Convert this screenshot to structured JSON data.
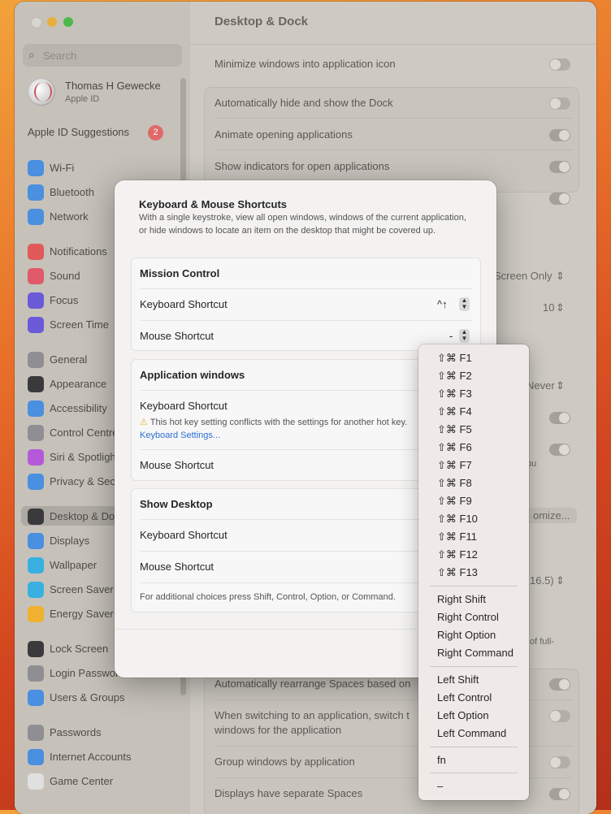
{
  "window": {
    "title": "Desktop & Dock"
  },
  "sidebar": {
    "search_placeholder": "Search",
    "user_name": "Thomas H Gewecke",
    "user_sub": "Apple ID",
    "suggestions": "Apple ID Suggestions",
    "suggestions_count": "2",
    "items": [
      {
        "label": "Wi-Fi",
        "color": "#4a8fe0",
        "icon": "wifi-icon"
      },
      {
        "label": "Bluetooth",
        "color": "#4a8fe0",
        "icon": "bluetooth-icon"
      },
      {
        "label": "Network",
        "color": "#4a8fe0",
        "icon": "globe-icon"
      },
      {
        "label": "Notifications",
        "color": "#e05a5a",
        "icon": "bell-icon"
      },
      {
        "label": "Sound",
        "color": "#e05a6a",
        "icon": "speaker-icon"
      },
      {
        "label": "Focus",
        "color": "#6a5ad8",
        "icon": "moon-icon"
      },
      {
        "label": "Screen Time",
        "color": "#6a5ad8",
        "icon": "hourglass-icon"
      },
      {
        "label": "General",
        "color": "#8e8e93",
        "icon": "gear-icon"
      },
      {
        "label": "Appearance",
        "color": "#3a3a3c",
        "icon": "appearance-icon"
      },
      {
        "label": "Accessibility",
        "color": "#4a8fe0",
        "icon": "accessibility-icon"
      },
      {
        "label": "Control Centre",
        "color": "#8e8e93",
        "icon": "control-centre-icon"
      },
      {
        "label": "Siri & Spotlight",
        "color": "#b45ad8",
        "icon": "siri-icon"
      },
      {
        "label": "Privacy & Security",
        "color": "#4a8fe0",
        "icon": "hand-icon"
      },
      {
        "label": "Desktop & Dock",
        "color": "#3a3a3c",
        "icon": "dock-icon"
      },
      {
        "label": "Displays",
        "color": "#4a8fe0",
        "icon": "sun-icon"
      },
      {
        "label": "Wallpaper",
        "color": "#3ab0e0",
        "icon": "wallpaper-icon"
      },
      {
        "label": "Screen Saver",
        "color": "#3ab0e0",
        "icon": "screensaver-icon"
      },
      {
        "label": "Energy Saver",
        "color": "#f0b030",
        "icon": "bulb-icon"
      },
      {
        "label": "Lock Screen",
        "color": "#3a3a3c",
        "icon": "lock-icon"
      },
      {
        "label": "Login Password",
        "color": "#8e8e93",
        "icon": "lock-icon"
      },
      {
        "label": "Users & Groups",
        "color": "#4a8fe0",
        "icon": "users-icon"
      },
      {
        "label": "Passwords",
        "color": "#8e8e93",
        "icon": "key-icon"
      },
      {
        "label": "Internet Accounts",
        "color": "#4a8fe0",
        "icon": "at-icon"
      },
      {
        "label": "Game Center",
        "color": "#e0e0e0",
        "icon": "gamecenter-icon"
      }
    ]
  },
  "main": {
    "rows": {
      "minimize": "Minimize windows into application icon",
      "autohide": "Automatically hide and show the Dock",
      "animate": "Animate opening applications",
      "indicators": "Show indicators for open applications",
      "screen_only": "Screen Only",
      "ten": "10",
      "never": "Never",
      "ou": "ou",
      "customize": "omize...",
      "version": "16.5)",
      "of_full": "of full-",
      "rearrange": "Automatically rearrange Spaces based on",
      "switching": "When switching to an application, switch t",
      "switching2": "windows for the application",
      "group": "Group windows by application",
      "separate": "Displays have separate Spaces"
    }
  },
  "dialog": {
    "title": "Keyboard & Mouse Shortcuts",
    "description": "With a single keystroke, view all open windows, windows of the current application, or hide windows to locate an item on the desktop that might be covered up.",
    "mission": {
      "title": "Mission Control",
      "kb_label": "Keyboard Shortcut",
      "kb_value": "^↑",
      "mouse_label": "Mouse Shortcut",
      "mouse_value": "-"
    },
    "appwin": {
      "title": "Application windows",
      "kb_label": "Keyboard Shortcut",
      "warning": "This hot key setting conflicts with the settings for another hot key.",
      "warning_link": "Keyboard Settings...",
      "mouse_label": "Mouse Shortcut"
    },
    "desktop": {
      "title": "Show Desktop",
      "kb_label": "Keyboard Shortcut",
      "mouse_label": "Mouse Shortcut",
      "footer": "For additional choices press Shift, Control, Option, or Command."
    }
  },
  "menu": {
    "fkeys": [
      "⇧⌘ F1",
      "⇧⌘ F2",
      "⇧⌘ F3",
      "⇧⌘ F4",
      "⇧⌘ F5",
      "⇧⌘ F6",
      "⇧⌘ F7",
      "⇧⌘ F8",
      "⇧⌘ F9",
      "⇧⌘ F10",
      "⇧⌘ F11",
      "⇧⌘ F12",
      "⇧⌘ F13"
    ],
    "right": [
      "Right Shift",
      "Right Control",
      "Right Option",
      "Right Command"
    ],
    "left": [
      "Left Shift",
      "Left Control",
      "Left Option",
      "Left Command"
    ],
    "fn": "fn",
    "none": "–"
  }
}
